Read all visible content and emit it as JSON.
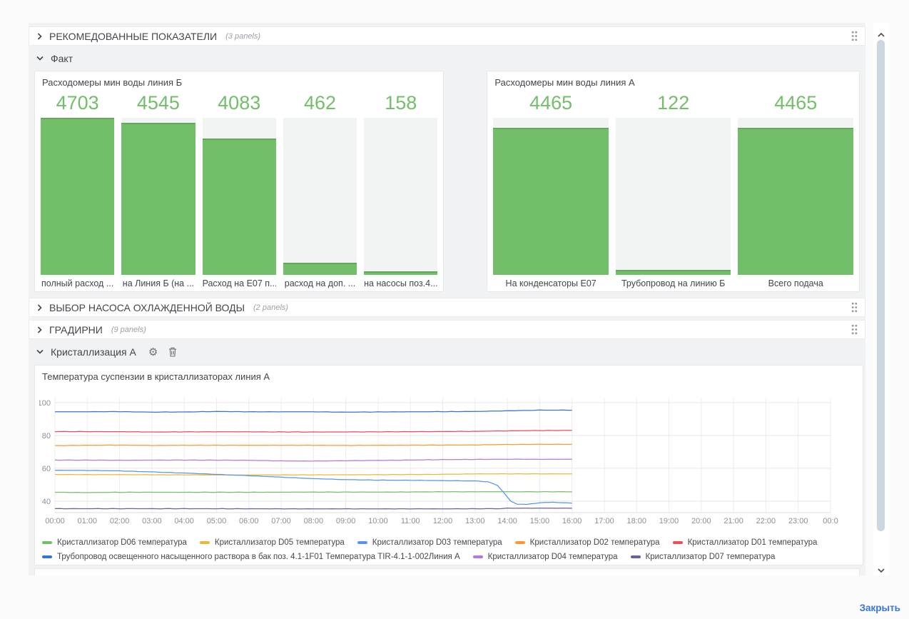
{
  "page": {
    "close_label": "Закрыть"
  },
  "rows": [
    {
      "key": "recommended",
      "title": "РЕКОМЕДОВАННЫЕ ПОКАЗАТЕЛИ",
      "count": "(3 panels)",
      "state": "collapsed"
    },
    {
      "key": "fact",
      "title": "Факт",
      "state": "expanded"
    },
    {
      "key": "pump-select",
      "title": "ВЫБОР НАСОСА ОХЛАЖДЕННОЙ ВОДЫ",
      "count": "(2 panels)",
      "state": "collapsed"
    },
    {
      "key": "cooling-towers",
      "title": "ГРАДИРНИ",
      "count": "(9 panels)",
      "state": "collapsed"
    },
    {
      "key": "crystallization-a",
      "title": "Кристаллизация А",
      "state": "expanded"
    }
  ],
  "chart_data": [
    {
      "type": "bar",
      "panel": "flow-line-b",
      "title": "Расходомеры мин воды линия Б",
      "categories": [
        "полный расход ...",
        "на Линия Б (на ...",
        "Расход на E07 п...",
        "расход на доп. ...",
        "на насосы поз.4..."
      ],
      "values": [
        4703,
        4545,
        4083,
        462,
        158
      ],
      "fill_pct": [
        100,
        96.8,
        87,
        7.7,
        2.5
      ],
      "bar_color": "#73BF69",
      "track_color": "#f2f4f4",
      "value_color": "#73BF69"
    },
    {
      "type": "bar",
      "panel": "flow-line-a",
      "title": "Расходомеры мин воды линия А",
      "categories": [
        "На конденсаторы E07",
        "Трубопровод на линию Б",
        "Всего подача"
      ],
      "values": [
        4465,
        122,
        4465
      ],
      "fill_pct": [
        93.6,
        3,
        93.6
      ],
      "bar_color": "#73BF69",
      "track_color": "#f2f4f4",
      "value_color": "#73BF69"
    },
    {
      "type": "line",
      "panel": "crystallizer-temps",
      "title": "Температура суспензии в кристаллизаторах линия А",
      "x_ticks": [
        "00:00",
        "01:00",
        "02:00",
        "03:00",
        "04:00",
        "05:00",
        "06:00",
        "07:00",
        "08:00",
        "09:00",
        "10:00",
        "11:00",
        "12:00",
        "13:00",
        "14:00",
        "15:00",
        "16:00",
        "17:00",
        "18:00",
        "19:00",
        "20:00",
        "21:00",
        "22:00",
        "23:00",
        "00:0"
      ],
      "x_range_hours": [
        0,
        24
      ],
      "y_ticks": [
        100,
        80,
        60,
        40
      ],
      "y_range": [
        33,
        103
      ],
      "grid": true,
      "legend_position": "bottom",
      "data_end_hour": 16,
      "series": [
        {
          "name": "Кристаллизатор D06 температура",
          "color": "#73BF69",
          "points": [
            [
              0,
              45.4
            ],
            [
              1,
              45.2
            ],
            [
              2,
              45.4
            ],
            [
              4,
              45.4
            ],
            [
              6,
              45.4
            ],
            [
              8,
              45.5
            ],
            [
              10,
              45.5
            ],
            [
              11,
              45.6
            ],
            [
              12,
              45.7
            ],
            [
              14,
              45.7
            ],
            [
              16,
              45.7
            ]
          ]
        },
        {
          "name": "Кристаллизатор D05 температура",
          "color": "#EAB839",
          "points": [
            [
              0,
              56.2
            ],
            [
              2,
              56.1
            ],
            [
              4,
              56.0
            ],
            [
              6,
              55.9
            ],
            [
              8,
              56.0
            ],
            [
              10,
              56.1
            ],
            [
              12,
              56.3
            ],
            [
              13,
              56.6
            ],
            [
              14,
              56.6
            ],
            [
              16,
              56.6
            ]
          ]
        },
        {
          "name": "Кристаллизатор D03 температура",
          "color": "#5794F2",
          "points": [
            [
              0,
              58.8
            ],
            [
              1,
              58.7
            ],
            [
              2,
              58.4
            ],
            [
              3,
              57.8
            ],
            [
              4,
              57.1
            ],
            [
              5,
              56.3
            ],
            [
              6,
              55.5
            ],
            [
              7,
              54.6
            ],
            [
              8,
              53.7
            ],
            [
              9,
              53.1
            ],
            [
              10,
              52.8
            ],
            [
              11,
              52.7
            ],
            [
              12,
              52.5
            ],
            [
              13,
              52.3
            ],
            [
              13.4,
              51.8
            ],
            [
              13.7,
              49.5
            ],
            [
              13.9,
              45.0
            ],
            [
              14.1,
              40.0
            ],
            [
              14.3,
              38.2
            ],
            [
              14.6,
              38.0
            ],
            [
              15,
              39.0
            ],
            [
              15.4,
              39.3
            ],
            [
              16,
              38.8
            ]
          ]
        },
        {
          "name": "Кристаллизатор D02 температура",
          "color": "#FF9830",
          "points": [
            [
              0,
              73.8
            ],
            [
              1,
              74.0
            ],
            [
              2,
              74.1
            ],
            [
              3,
              73.9
            ],
            [
              4,
              74.0
            ],
            [
              6,
              74.0
            ],
            [
              8,
              74.0
            ],
            [
              9,
              73.9
            ],
            [
              10,
              74.0
            ],
            [
              12,
              74.1
            ],
            [
              13,
              74.2
            ],
            [
              14,
              74.5
            ],
            [
              15,
              74.6
            ],
            [
              16,
              74.6
            ]
          ]
        },
        {
          "name": "Кристаллизатор D01 температура",
          "color": "#F2495C",
          "points": [
            [
              0,
              82.4
            ],
            [
              2,
              82.3
            ],
            [
              3,
              82.1
            ],
            [
              4,
              82.2
            ],
            [
              6,
              82.2
            ],
            [
              8,
              82.1
            ],
            [
              10,
              82.2
            ],
            [
              12,
              82.4
            ],
            [
              13,
              82.5
            ],
            [
              14,
              82.8
            ],
            [
              15,
              83.0
            ],
            [
              16,
              83.1
            ]
          ]
        },
        {
          "name": "Трубопровод освещенного насыщенного раствора в бак поз. 4.1-1F01 Температура TIR-4.1-1-002Линия А",
          "color": "#3274D9",
          "points": [
            [
              0,
              94.4
            ],
            [
              2,
              94.5
            ],
            [
              3,
              94.2
            ],
            [
              4,
              94.3
            ],
            [
              5,
              94.6
            ],
            [
              6,
              94.4
            ],
            [
              8,
              94.4
            ],
            [
              9,
              94.2
            ],
            [
              10,
              94.3
            ],
            [
              12,
              94.5
            ],
            [
              13,
              94.6
            ],
            [
              13.8,
              94.9
            ],
            [
              14.5,
              95.2
            ],
            [
              15,
              95.4
            ],
            [
              16,
              95.4
            ]
          ]
        },
        {
          "name": "Кристаллизатор D04 температура",
          "color": "#B877D9",
          "points": [
            [
              0,
              65.0
            ],
            [
              2,
              64.9
            ],
            [
              4,
              65.0
            ],
            [
              6,
              64.9
            ],
            [
              7,
              64.5
            ],
            [
              8,
              64.4
            ],
            [
              9,
              64.6
            ],
            [
              10,
              64.8
            ],
            [
              11,
              65.0
            ],
            [
              12,
              65.3
            ],
            [
              13,
              65.4
            ],
            [
              14,
              65.5
            ],
            [
              16,
              65.5
            ]
          ]
        },
        {
          "name": "Кристаллизатор D07 температура",
          "color": "#705DA0",
          "points": [
            [
              0,
              35.4
            ],
            [
              4,
              35.4
            ],
            [
              8,
              35.3
            ],
            [
              12,
              35.3
            ],
            [
              13.8,
              35.4
            ],
            [
              14,
              35.7
            ],
            [
              16,
              35.7
            ]
          ]
        }
      ],
      "legend_rows": [
        [
          0,
          1,
          2,
          3,
          4
        ],
        [
          5,
          6,
          7
        ]
      ]
    }
  ]
}
